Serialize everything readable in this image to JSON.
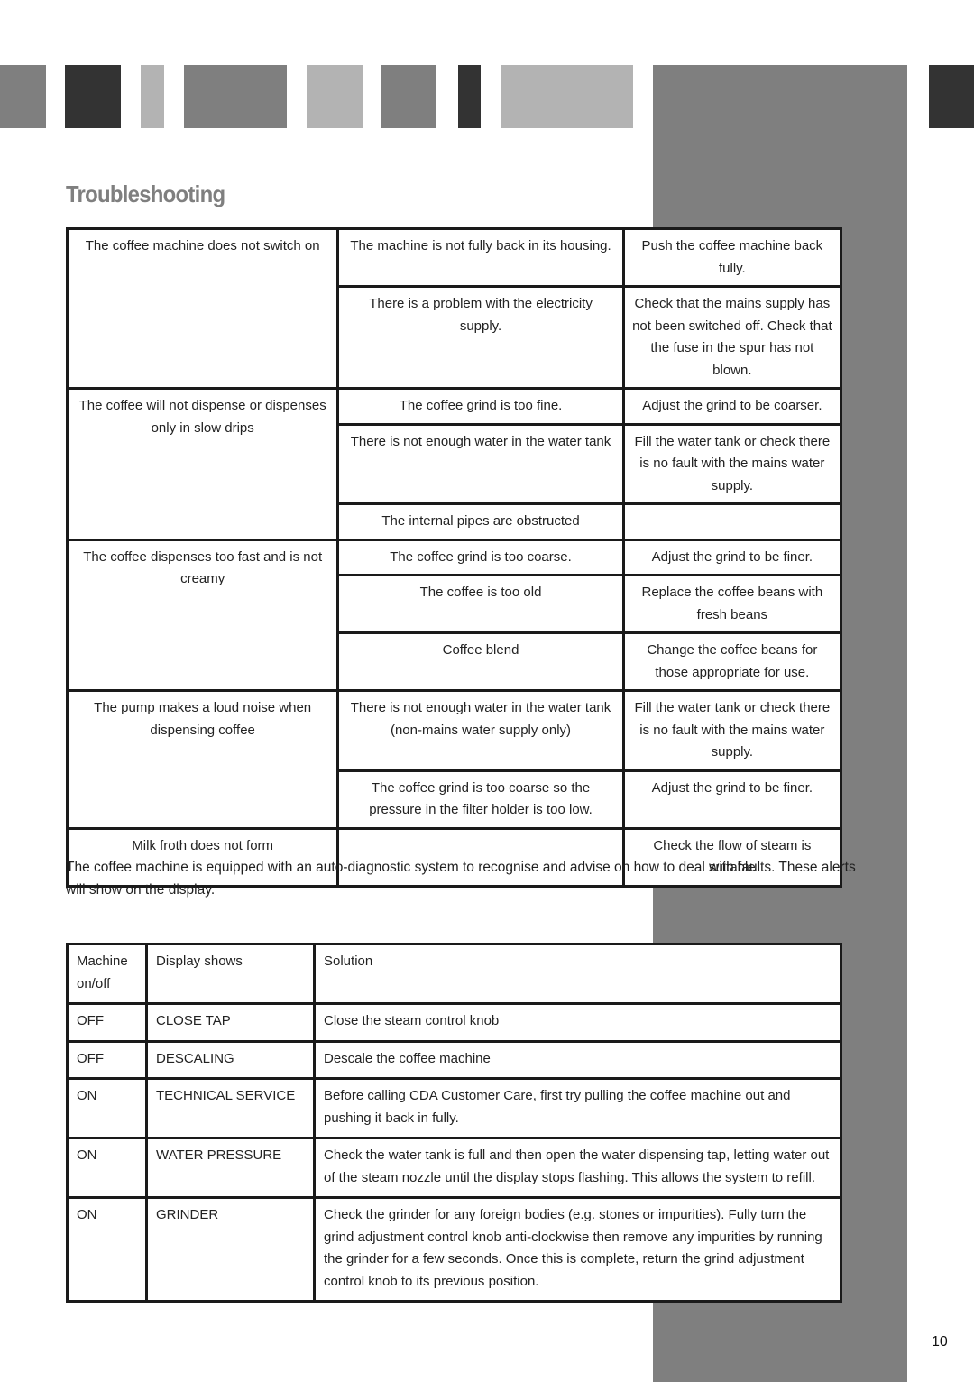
{
  "header": {
    "bars": [
      {
        "color": "#7f7f7f"
      },
      {
        "color": "#333333"
      },
      {
        "color": "#b3b3b3"
      },
      {
        "color": "#7f7f7f"
      },
      {
        "color": "#b3b3b3"
      },
      {
        "color": "#7f7f7f"
      },
      {
        "color": "#333333"
      },
      {
        "color": "#b3b3b3"
      },
      {
        "color": "#7f7f7f"
      },
      {
        "color": "#333333"
      }
    ]
  },
  "page": {
    "title": "Troubleshooting",
    "page_number": "10"
  },
  "troubleshooting_table": {
    "groups": [
      {
        "problem": "The coffee machine does not switch on",
        "rows": [
          {
            "cause": "The machine is not fully back in its housing.",
            "solution": "Push the coffee machine back fully."
          },
          {
            "cause": "There is a problem with the electricity supply.",
            "solution": "Check that the mains supply has not been switched off. Check that the fuse in the spur has not blown."
          }
        ]
      },
      {
        "problem": "The coffee will not dispense or dispenses only in slow drips",
        "rows": [
          {
            "cause": "The coffee grind is too fine.",
            "solution": "Adjust the grind to be coarser."
          },
          {
            "cause": "There is not enough water in the water tank",
            "solution": "Fill the water tank or check there is no fault with the mains water supply."
          },
          {
            "cause": "The internal pipes are obstructed",
            "solution": ""
          }
        ]
      },
      {
        "problem": "The coffee dispenses too fast and is not creamy",
        "rows": [
          {
            "cause": "The coffee grind is too coarse.",
            "solution": "Adjust the grind to be finer."
          },
          {
            "cause": "The coffee is too old",
            "solution": "Replace the coffee beans with fresh beans"
          },
          {
            "cause": "Coffee blend",
            "solution": "Change the coffee beans for those appropriate for use."
          }
        ]
      },
      {
        "problem": "The pump makes a loud noise when dispensing coffee",
        "rows": [
          {
            "cause": "There is not enough water in the water tank (non-mains water supply only)",
            "solution": "Fill the water tank or check there is no fault with the mains water supply."
          },
          {
            "cause": "The coffee grind is too coarse so the pressure in the filter holder is too low.",
            "solution": "Adjust the grind to be finer."
          }
        ]
      },
      {
        "problem": "Milk froth does not form",
        "rows": [
          {
            "cause": "",
            "solution": "Check the flow of steam is suitable"
          }
        ]
      }
    ]
  },
  "intro_paragraph": "The coffee machine is equipped with an auto-diagnostic system to recognise and advise on how to deal with faults. These alerts will show on the display.",
  "alerts_table": {
    "headers": [
      "Machine on/off",
      "Display shows",
      "Solution"
    ],
    "rows": [
      {
        "state": "OFF",
        "display": "CLOSE TAP",
        "solution": "Close the steam control knob"
      },
      {
        "state": "OFF",
        "display": "DESCALING",
        "solution": "Descale the coffee machine"
      },
      {
        "state": "ON",
        "display": "TECHNICAL SERVICE",
        "solution": "Before calling CDA Customer Care, first try pulling the coffee machine out and pushing it back in fully."
      },
      {
        "state": "ON",
        "display": "WATER PRESSURE",
        "solution": "Check the water tank is full and then open the water dispensing tap, letting water out of the steam nozzle until the display stops flashing.  This allows the system to refill."
      },
      {
        "state": "ON",
        "display": "GRINDER",
        "solution": "Check the grinder for any foreign bodies (e.g. stones or impurities).  Fully turn the grind adjustment control knob anti-clockwise then remove any impurities by running the grinder for a few seconds.  Once this is complete, return the grind adjustment control knob to its previous position."
      }
    ]
  }
}
